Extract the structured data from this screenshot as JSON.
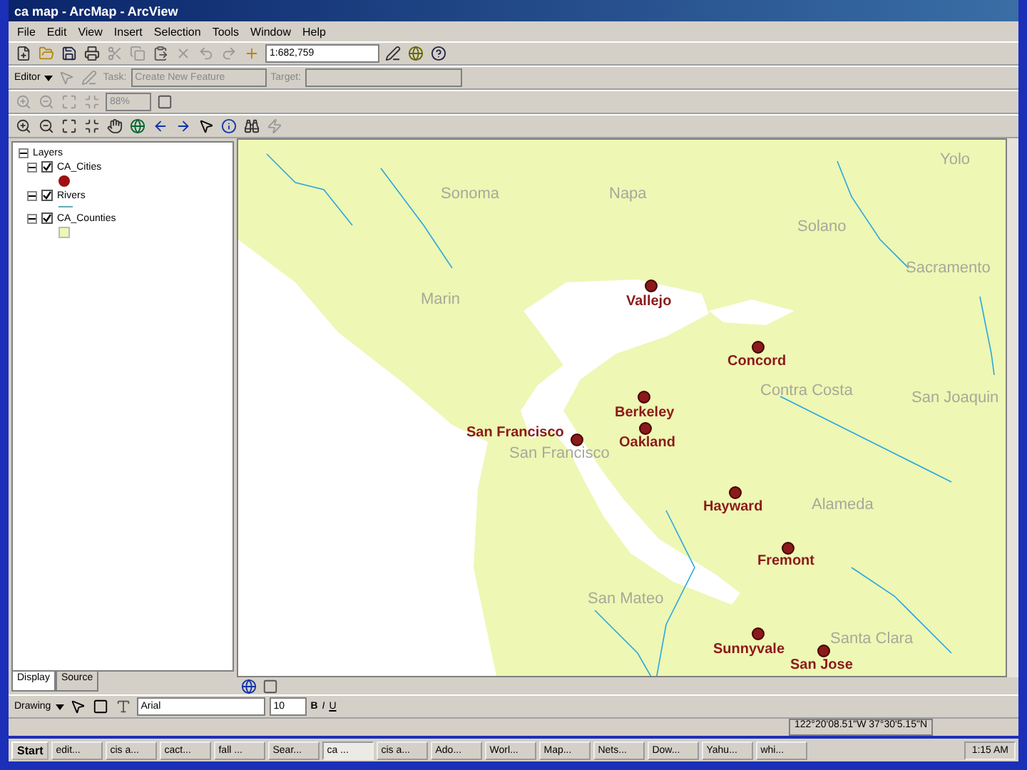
{
  "window": {
    "title": "ca map - ArcMap - ArcView"
  },
  "menu": [
    "File",
    "Edit",
    "View",
    "Insert",
    "Selection",
    "Tools",
    "Window",
    "Help"
  ],
  "standard_toolbar": {
    "scale": "1:682,759"
  },
  "editor_toolbar": {
    "editor": "Editor",
    "task_label": "Task:",
    "task": "Create New Feature",
    "target_label": "Target:"
  },
  "layout_toolbar": {
    "zoom": "88%"
  },
  "toc": {
    "root": "Layers",
    "expanded": true,
    "layers": [
      {
        "name": "CA_Cities",
        "checked": true,
        "expanded": true,
        "kind": "point"
      },
      {
        "name": "Rivers",
        "checked": true,
        "expanded": true,
        "kind": "line"
      },
      {
        "name": "CA_Counties",
        "checked": true,
        "expanded": true,
        "kind": "polygon"
      }
    ],
    "tabs": [
      {
        "label": "Display",
        "selected": true
      },
      {
        "label": "Source",
        "selected": false
      }
    ]
  },
  "map": {
    "counties": [
      "Yolo",
      "Sonoma",
      "Napa",
      "Solano",
      "Sacramento",
      "Marin",
      "Contra Costa",
      "San Joaquin",
      "San Francisco",
      "Alameda",
      "San Mateo",
      "Santa Clara"
    ],
    "cities": [
      "Vallejo",
      "Concord",
      "Berkeley",
      "Oakland",
      "San Francisco",
      "Hayward",
      "Fremont",
      "Sunnyvale",
      "San Jose"
    ]
  },
  "drawing_toolbar": {
    "drawing": "Drawing",
    "font": "Arial",
    "size": "10",
    "bold": "B",
    "italic": "I",
    "underline": "U"
  },
  "status_bar": {
    "coordinates": "122°20'08.51\"W 37°30'5.15\"N"
  },
  "taskbar": {
    "start": "Start",
    "clock": "1:15 AM",
    "items": [
      {
        "label": "edit...",
        "selected": false
      },
      {
        "label": "cis a...",
        "selected": false
      },
      {
        "label": "cact...",
        "selected": false
      },
      {
        "label": "fall ...",
        "selected": false
      },
      {
        "label": "Sear...",
        "selected": false
      },
      {
        "label": "ca ...",
        "selected": true
      },
      {
        "label": "cis a...",
        "selected": false
      },
      {
        "label": "Ado...",
        "selected": false
      },
      {
        "label": "Worl...",
        "selected": false
      },
      {
        "label": "Map...",
        "selected": false
      },
      {
        "label": "Nets...",
        "selected": false
      },
      {
        "label": "Dow...",
        "selected": false
      },
      {
        "label": "Yahu...",
        "selected": false
      },
      {
        "label": "whi...",
        "selected": false
      }
    ]
  }
}
